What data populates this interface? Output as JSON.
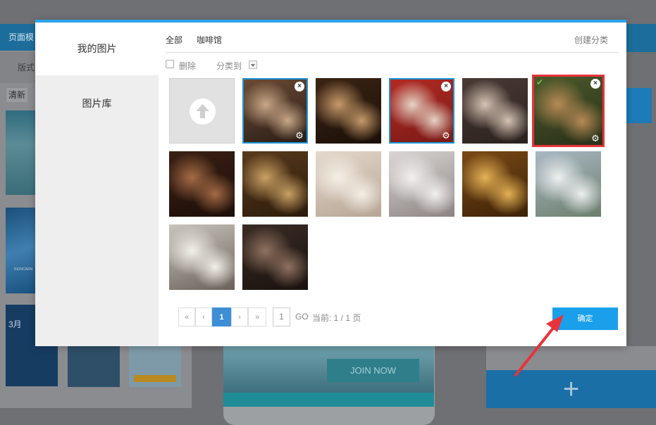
{
  "background": {
    "left_tab_label": "页面模",
    "left_sub_label": "版式",
    "left_button_label": "清新",
    "thumb_small_text": "REINCARN",
    "thumb_month_text": "3月",
    "join_button_label": "JOIN NOW",
    "add_button_label": "+"
  },
  "sidebar": {
    "items": [
      {
        "label": "我的图片",
        "active": true
      },
      {
        "label": "图片库",
        "active": false
      }
    ]
  },
  "categories": {
    "all": "全部",
    "cafe": "咖啡馆",
    "create": "创建分类"
  },
  "actions": {
    "delete_label": "删除",
    "move_label": "分类到"
  },
  "upload_tile": {
    "icon": "upload-arrow-icon"
  },
  "images": [
    {
      "name": "couple-on-chair",
      "selected": "blue",
      "colors": [
        "#6b4a33",
        "#c9a888",
        "#2a1e18"
      ]
    },
    {
      "name": "coffee-cup",
      "selected": "none",
      "colors": [
        "#3b2414",
        "#c89a6a",
        "#1a0f08"
      ]
    },
    {
      "name": "couple-red-phonebooth",
      "selected": "blue",
      "colors": [
        "#b22a23",
        "#e6d4c6",
        "#7a1a16"
      ]
    },
    {
      "name": "couple-cafe-table",
      "selected": "none",
      "colors": [
        "#4a3a34",
        "#d5c3b4",
        "#2b211d"
      ]
    },
    {
      "name": "cafe-sign",
      "selected": "red",
      "colors": [
        "#4b5a2a",
        "#b88a55",
        "#2a3019"
      ]
    },
    {
      "name": "cafe-interior-1",
      "selected": "none",
      "colors": [
        "#3a1f14",
        "#a56b45",
        "#1d0f09"
      ]
    },
    {
      "name": "cafe-interior-2",
      "selected": "none",
      "colors": [
        "#5a3a1c",
        "#c9a163",
        "#2b1b0c"
      ]
    },
    {
      "name": "couple-lying",
      "selected": "none",
      "colors": [
        "#e4d9cc",
        "#f6efe6",
        "#b7a594"
      ]
    },
    {
      "name": "couple-kiss-white",
      "selected": "none",
      "colors": [
        "#d9d6d4",
        "#f2f1f0",
        "#8c8482"
      ]
    },
    {
      "name": "couple-golden-light",
      "selected": "none",
      "colors": [
        "#7a4a16",
        "#e5b255",
        "#3d2207"
      ]
    },
    {
      "name": "couple-outdoor",
      "selected": "none",
      "colors": [
        "#a9b8c4",
        "#eef0f0",
        "#6c7f6c"
      ]
    },
    {
      "name": "couple-window",
      "selected": "none",
      "colors": [
        "#c8c4bc",
        "#f3f0ea",
        "#6b625a"
      ]
    },
    {
      "name": "couple-street",
      "selected": "none",
      "colors": [
        "#3a2c24",
        "#8f7260",
        "#1a120e"
      ]
    }
  ],
  "pagination": {
    "first": "«",
    "prev": "‹",
    "current": "1",
    "next": "›",
    "last": "»",
    "jump_value": "1",
    "go_label": "GO",
    "info": "当前: 1 / 1 页"
  },
  "confirm_button": "确定",
  "colors": {
    "accent": "#1aa0ea",
    "modal_top_bar": "#2aa3e8",
    "selection_blue": "#1e95d6",
    "selection_red": "#e8333b",
    "annotation_arrow": "#e8333b"
  }
}
